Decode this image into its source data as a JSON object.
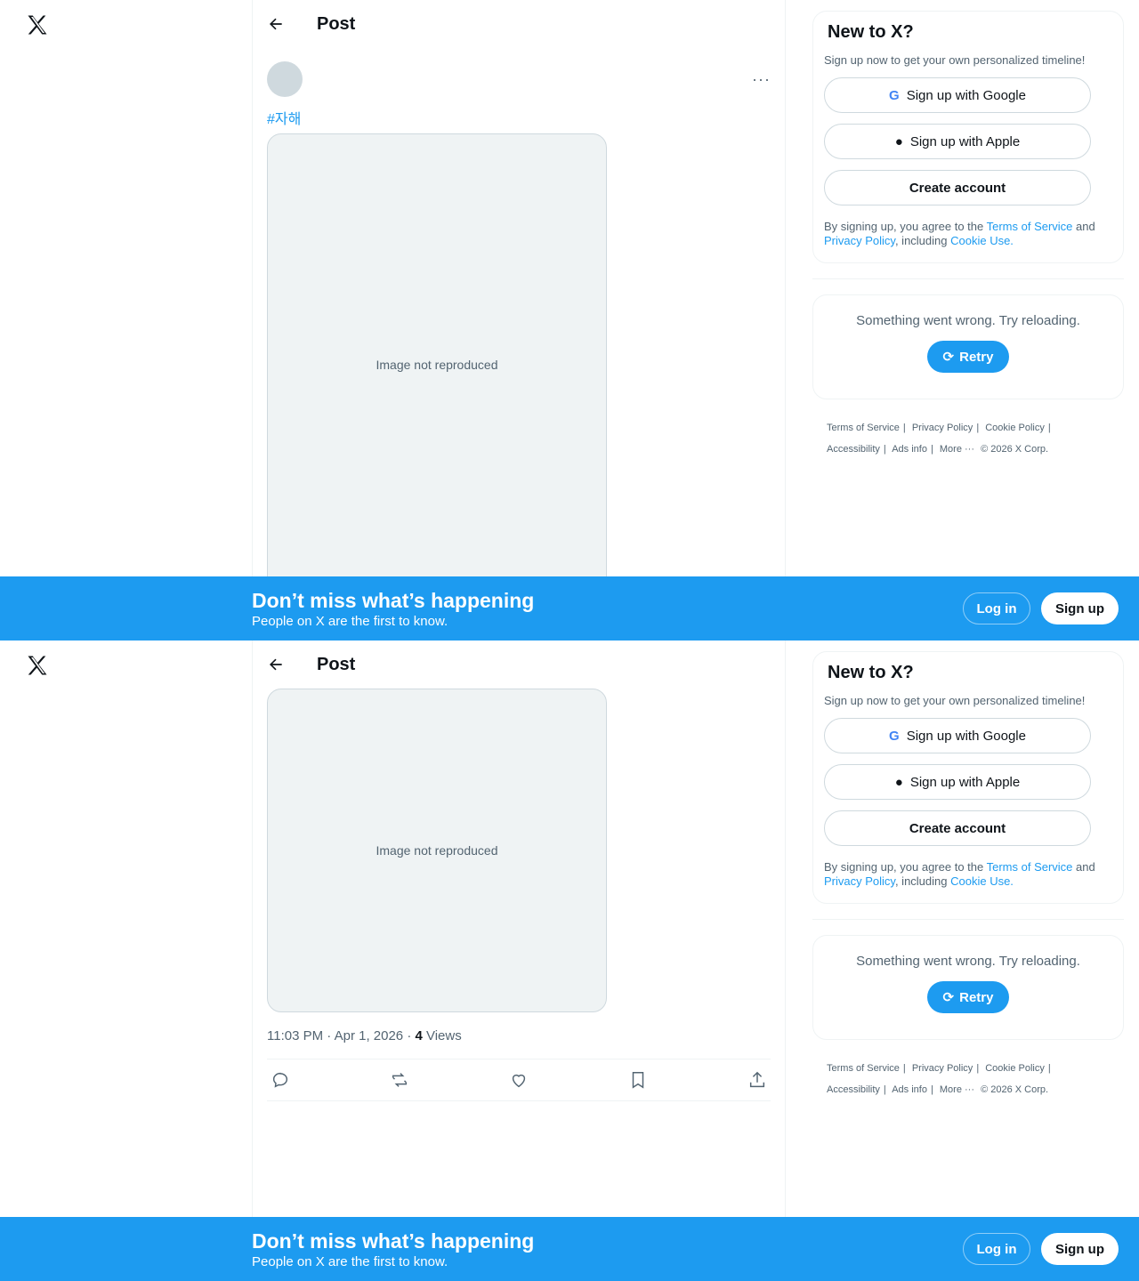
{
  "header": {
    "title": "Post"
  },
  "post": {
    "hashtag": "#자해",
    "media_placeholder": "Image not reproduced",
    "time": "11:03 PM · Apr 1, 2026 · ",
    "views_count": "4",
    "views_label": " Views"
  },
  "signup": {
    "title": "New to X?",
    "subtitle": "Sign up now to get your own personalized timeline!",
    "google": "Sign up with Google",
    "apple": "Sign up with Apple",
    "create": "Create account",
    "terms_prefix": "By signing up, you agree to the ",
    "terms_link": "Terms of Service",
    "terms_and": " and ",
    "privacy_link": "Privacy Policy",
    "terms_including": ", including ",
    "cookie_link": "Cookie Use."
  },
  "error": {
    "message": "Something went wrong. Try reloading.",
    "retry": "Retry"
  },
  "footer": {
    "tos": "Terms of Service",
    "privacy": "Privacy Policy",
    "cookie": "Cookie Policy",
    "accessibility": "Accessibility",
    "ads": "Ads info",
    "more": "More ···",
    "copyright": "© 2026 X Corp."
  },
  "banner": {
    "headline": "Don’t miss what’s happening",
    "sub": "People on X are the first to know.",
    "login": "Log in",
    "signup": "Sign up"
  },
  "colors": {
    "accent": "#1d9bf0",
    "text": "#0f1419",
    "muted": "#536471"
  }
}
